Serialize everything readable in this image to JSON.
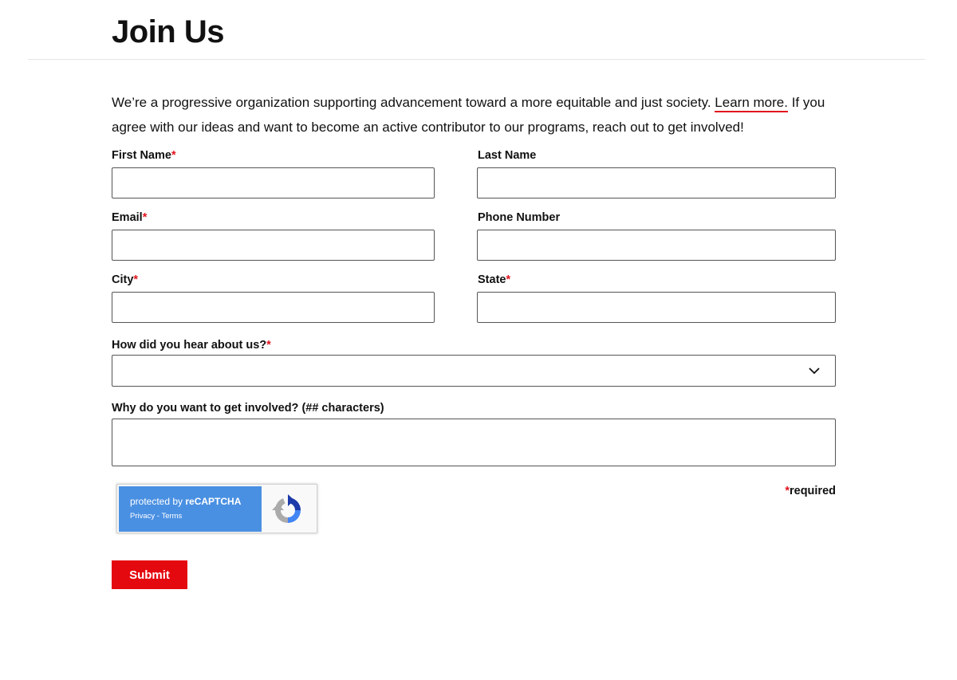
{
  "page": {
    "title": "Join Us",
    "intro_before": "We’re a progressive organization supporting advancement toward a more equitable and just society. ",
    "learn_more": "Learn more.",
    "intro_after": " If you agree with our ideas and want to become an active contributor to our programs, reach out to get involved!"
  },
  "form": {
    "first_name": {
      "label": "First Name",
      "required_mark": "*",
      "value": ""
    },
    "last_name": {
      "label": "Last Name",
      "value": ""
    },
    "email": {
      "label": "Email",
      "required_mark": "*",
      "value": ""
    },
    "phone": {
      "label": "Phone Number",
      "value": ""
    },
    "city": {
      "label": "City",
      "required_mark": "*",
      "value": ""
    },
    "state": {
      "label": "State",
      "required_mark": "*",
      "value": ""
    },
    "hear_about": {
      "label": "How did you hear about us?",
      "required_mark": "*",
      "selected": ""
    },
    "why_involved": {
      "label": "Why do you want to get involved? (## characters)",
      "value": ""
    },
    "required_note_mark": "*",
    "required_note_text": "required",
    "submit_label": "Submit"
  },
  "recaptcha": {
    "protected_by": "protected by ",
    "brand": "reCAPTCHA",
    "privacy": "Privacy",
    "separator": " - ",
    "terms": "Terms"
  },
  "colors": {
    "accent_red": "#e4090f",
    "recaptcha_blue": "#4a90e2"
  },
  "icons": {
    "select_chevron": "chevron-down-icon",
    "recaptcha_logo": "recaptcha-logo-icon"
  }
}
